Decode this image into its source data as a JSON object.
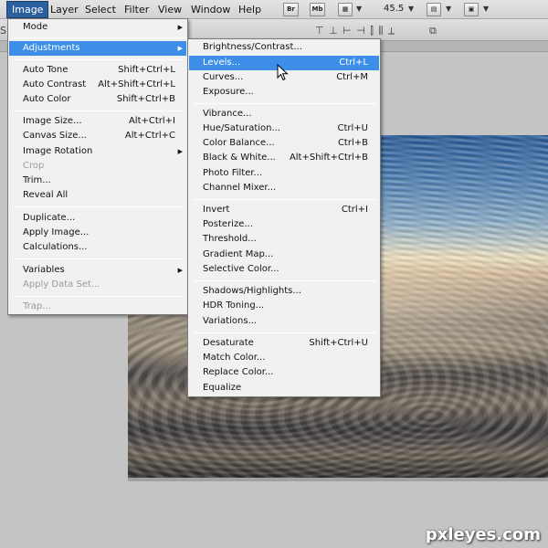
{
  "menubar": {
    "items": [
      "Image",
      "Layer",
      "Select",
      "Filter",
      "View",
      "Window",
      "Help"
    ],
    "active": "Image",
    "br_label": "Br",
    "mb_label": "Mb",
    "zoom": "45.5"
  },
  "optbar": {
    "left_fragment": "Sc"
  },
  "image_menu": [
    {
      "label": "Mode",
      "submenu": true
    },
    {
      "label": "Adjustments",
      "submenu": true,
      "selected": true
    },
    {
      "label": "Auto Tone",
      "shortcut": "Shift+Ctrl+L"
    },
    {
      "label": "Auto Contrast",
      "shortcut": "Alt+Shift+Ctrl+L"
    },
    {
      "label": "Auto Color",
      "shortcut": "Shift+Ctrl+B"
    },
    {
      "label": "Image Size...",
      "shortcut": "Alt+Ctrl+I"
    },
    {
      "label": "Canvas Size...",
      "shortcut": "Alt+Ctrl+C"
    },
    {
      "label": "Image Rotation",
      "submenu": true
    },
    {
      "label": "Crop",
      "disabled": true
    },
    {
      "label": "Trim..."
    },
    {
      "label": "Reveal All"
    },
    {
      "label": "Duplicate..."
    },
    {
      "label": "Apply Image..."
    },
    {
      "label": "Calculations..."
    },
    {
      "label": "Variables",
      "submenu": true
    },
    {
      "label": "Apply Data Set...",
      "disabled": true
    },
    {
      "label": "Trap...",
      "disabled": true
    }
  ],
  "adjustments_menu": [
    {
      "label": "Brightness/Contrast..."
    },
    {
      "label": "Levels...",
      "shortcut": "Ctrl+L",
      "selected": true
    },
    {
      "label": "Curves...",
      "shortcut": "Ctrl+M"
    },
    {
      "label": "Exposure..."
    },
    {
      "label": "Vibrance..."
    },
    {
      "label": "Hue/Saturation...",
      "shortcut": "Ctrl+U"
    },
    {
      "label": "Color Balance...",
      "shortcut": "Ctrl+B"
    },
    {
      "label": "Black & White...",
      "shortcut": "Alt+Shift+Ctrl+B"
    },
    {
      "label": "Photo Filter..."
    },
    {
      "label": "Channel Mixer..."
    },
    {
      "label": "Invert",
      "shortcut": "Ctrl+I"
    },
    {
      "label": "Posterize..."
    },
    {
      "label": "Threshold..."
    },
    {
      "label": "Gradient Map..."
    },
    {
      "label": "Selective Color..."
    },
    {
      "label": "Shadows/Highlights..."
    },
    {
      "label": "HDR Toning..."
    },
    {
      "label": "Variations..."
    },
    {
      "label": "Desaturate",
      "shortcut": "Shift+Ctrl+U"
    },
    {
      "label": "Match Color..."
    },
    {
      "label": "Replace Color..."
    },
    {
      "label": "Equalize"
    }
  ],
  "watermark": "pxleyes.com",
  "colors": {
    "menu_highlight": "#3d8ee8",
    "menubar_active": "#2c5f9e"
  }
}
